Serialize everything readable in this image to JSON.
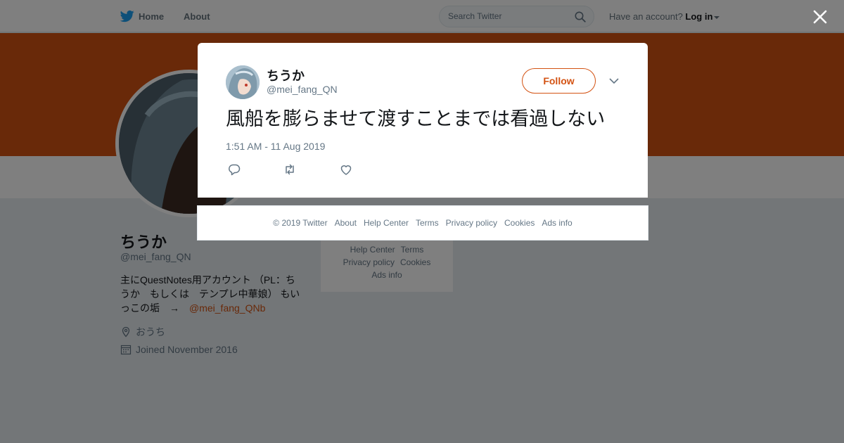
{
  "nav": {
    "home_label": "Home",
    "about_label": "About",
    "search_placeholder": "Search Twitter",
    "account_prompt": "Have an account?",
    "login_label": "Log in"
  },
  "profile": {
    "name": "ちうか",
    "handle": "@mei_fang_QN",
    "bio_text": "主にQuestNotes用アカウント （PL：ちうか　もしくは　テンプレ中華娘） もいっこの垢　→　",
    "bio_mention": "@mei_fang_QNb",
    "location": "おうち",
    "joined": "Joined November 2016",
    "side_links": [
      "Help Center",
      "Terms",
      "Privacy policy",
      "Cookies",
      "Ads info"
    ]
  },
  "tweet": {
    "author_name": "ちうか",
    "author_handle": "@mei_fang_QN",
    "follow_label": "Follow",
    "text": "風船を膨らませて渡すことまでは看過しない",
    "timestamp": "1:51 AM - 11 Aug 2019"
  },
  "footer": {
    "links": [
      "© 2019 Twitter",
      "About",
      "Help Center",
      "Terms",
      "Privacy policy",
      "Cookies",
      "Ads info"
    ]
  },
  "colors": {
    "accent": "#d35212",
    "brand_blue": "#1da1f2",
    "page_bg": "#e6ecf0"
  },
  "icons": [
    "twitter-bird-icon",
    "search-icon",
    "close-icon",
    "chevron-down-icon",
    "reply-icon",
    "retweet-icon",
    "like-icon",
    "location-icon",
    "calendar-icon"
  ]
}
